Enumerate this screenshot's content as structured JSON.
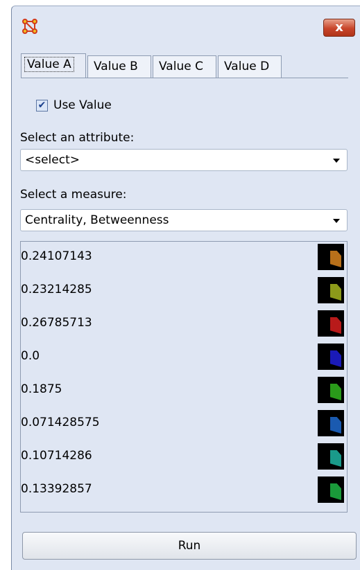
{
  "window": {
    "close_label": "x"
  },
  "tabs": [
    {
      "label": "Value A"
    },
    {
      "label": "Value B"
    },
    {
      "label": "Value C"
    },
    {
      "label": "Value D"
    }
  ],
  "use_value": {
    "label": "Use Value",
    "checked": true
  },
  "attribute": {
    "label": "Select an attribute:",
    "value": "<select>"
  },
  "measure": {
    "label": "Select a measure:",
    "value": "Centrality, Betweenness"
  },
  "values": [
    {
      "value": "0.24107143",
      "color": "#b8701a"
    },
    {
      "value": "0.23214285",
      "color": "#8c9a1a"
    },
    {
      "value": "0.26785713",
      "color": "#b81a1a"
    },
    {
      "value": "0.0",
      "color": "#1a1ab8"
    },
    {
      "value": "0.1875",
      "color": "#2a9a1a"
    },
    {
      "value": "0.071428575",
      "color": "#1a5ab0"
    },
    {
      "value": "0.10714286",
      "color": "#1a9a8a"
    },
    {
      "value": "0.13392857",
      "color": "#1a9a3a"
    }
  ],
  "run_label": "Run"
}
